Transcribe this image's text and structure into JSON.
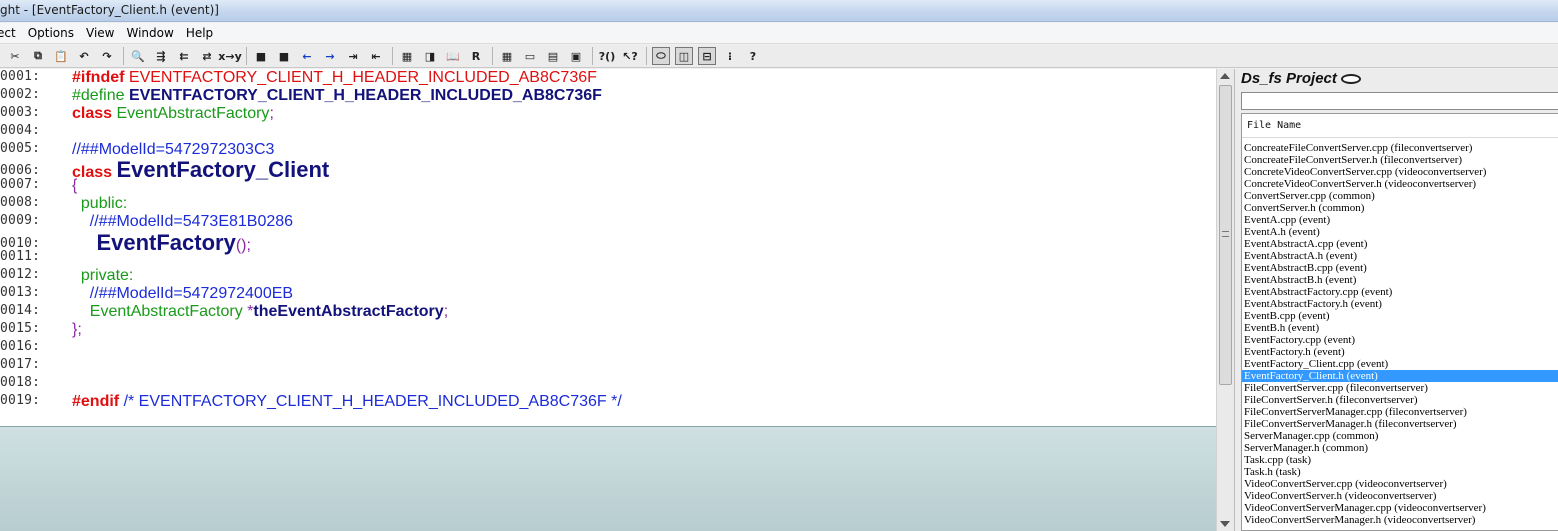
{
  "window": {
    "title": "ght - [EventFactory_Client.h (event)]"
  },
  "menu": [
    "ect",
    "Options",
    "View",
    "Window",
    "Help"
  ],
  "toolbar": {
    "buttons": [
      {
        "name": "cut-icon",
        "glyph": "✂"
      },
      {
        "name": "copy-icon",
        "glyph": "⧉"
      },
      {
        "name": "paste-icon",
        "glyph": "📋"
      },
      {
        "name": "undo-icon",
        "glyph": "↶"
      },
      {
        "name": "redo-icon",
        "glyph": "↷"
      },
      {
        "name": "find-icon",
        "glyph": "🔍"
      },
      {
        "name": "find-next-icon",
        "glyph": "⇶"
      },
      {
        "name": "find-prev-icon",
        "glyph": "⇇"
      },
      {
        "name": "replace-icon",
        "glyph": "⇄"
      },
      {
        "name": "regex-icon",
        "glyph": "x→y"
      },
      {
        "name": "bookmark-toggle-icon",
        "glyph": "■"
      },
      {
        "name": "bookmark-clear-icon",
        "glyph": "■"
      },
      {
        "name": "back-arrow-icon",
        "glyph": "←"
      },
      {
        "name": "forward-arrow-icon",
        "glyph": "→"
      },
      {
        "name": "jump-icon",
        "glyph": "⇥"
      },
      {
        "name": "jump-back-icon",
        "glyph": "⇤"
      },
      {
        "name": "browse-icon",
        "glyph": "▦"
      },
      {
        "name": "symbol-icon",
        "glyph": "◨"
      },
      {
        "name": "book-icon",
        "glyph": "📖"
      },
      {
        "name": "relation-icon",
        "glyph": "R"
      },
      {
        "name": "layout-1-icon",
        "glyph": "▦"
      },
      {
        "name": "layout-2-icon",
        "glyph": "▭"
      },
      {
        "name": "layout-3-icon",
        "glyph": "▤"
      },
      {
        "name": "layout-4-icon",
        "glyph": "▣"
      },
      {
        "name": "info-icon",
        "glyph": "?()"
      },
      {
        "name": "context-help-icon",
        "glyph": "↖?"
      },
      {
        "name": "project-toggle-icon",
        "glyph": "⬭"
      },
      {
        "name": "context-window-icon",
        "glyph": "◫"
      },
      {
        "name": "relation-window-icon",
        "glyph": "⊟"
      },
      {
        "name": "symbol-window-icon",
        "glyph": "⁝"
      },
      {
        "name": "help-window-icon",
        "glyph": "?"
      }
    ]
  },
  "editor": {
    "lines": [
      {
        "num": "00001:",
        "segments": [
          {
            "t": "#ifndef ",
            "c": "kw-red"
          },
          {
            "t": "EVENTFACTORY_CLIENT_H_HEADER_INCLUDED_AB8C736F",
            "c": "red"
          }
        ]
      },
      {
        "num": "00002:",
        "segments": [
          {
            "t": "#define ",
            "c": "green"
          },
          {
            "t": "EVENTFACTORY_CLIENT_H_HEADER_INCLUDED_AB8C736F",
            "c": "navy"
          }
        ]
      },
      {
        "num": "00003:",
        "segments": [
          {
            "t": "class ",
            "c": "kw-red"
          },
          {
            "t": "EventAbstractFactory",
            "c": "green"
          },
          {
            "t": ";",
            "c": "purple"
          }
        ]
      },
      {
        "num": "00004:",
        "segments": []
      },
      {
        "num": "00005:",
        "segments": [
          {
            "t": "//##ModelId=5472972303C3",
            "c": "blue"
          }
        ]
      },
      {
        "num": "00006:",
        "segments": [
          {
            "t": "class ",
            "c": "kw-red"
          },
          {
            "t": "EventFactory_Client",
            "c": "big"
          }
        ]
      },
      {
        "num": "00007:",
        "segments": [
          {
            "t": "{",
            "c": "purple"
          }
        ]
      },
      {
        "num": "00008:",
        "segments": [
          {
            "t": "  public:",
            "c": "green"
          }
        ]
      },
      {
        "num": "00009:",
        "segments": [
          {
            "t": "    //##ModelId=5473E81B0286",
            "c": "blue"
          }
        ]
      },
      {
        "num": "00010:",
        "segments": [
          {
            "t": "    EventFactory",
            "c": "big"
          },
          {
            "t": "();",
            "c": "purple"
          }
        ]
      },
      {
        "num": "00011:",
        "segments": []
      },
      {
        "num": "00012:",
        "segments": [
          {
            "t": "  private:",
            "c": "green"
          }
        ]
      },
      {
        "num": "00013:",
        "segments": [
          {
            "t": "    //##ModelId=5472972400EB",
            "c": "blue"
          }
        ]
      },
      {
        "num": "00014:",
        "segments": [
          {
            "t": "    EventAbstractFactory ",
            "c": "green"
          },
          {
            "t": "*",
            "c": "purple"
          },
          {
            "t": "theEventAbstractFactory",
            "c": "navy"
          },
          {
            "t": ";",
            "c": "purple"
          }
        ]
      },
      {
        "num": "00015:",
        "segments": [
          {
            "t": "};",
            "c": "purple"
          }
        ]
      },
      {
        "num": "00016:",
        "segments": []
      },
      {
        "num": "00017:",
        "segments": []
      },
      {
        "num": "00018:",
        "segments": []
      },
      {
        "num": "00019:",
        "segments": [
          {
            "t": "#endif ",
            "c": "kw-red"
          },
          {
            "t": "/* EVENTFACTORY_CLIENT_H_HEADER_INCLUDED_AB8C736F */",
            "c": "blue"
          }
        ]
      }
    ]
  },
  "project": {
    "title": "Ds_fs Project",
    "column_header": "File Name",
    "search_value": "",
    "selected_index": 19,
    "files": [
      "ConcreateFileConvertServer.cpp (fileconvertserver)",
      "ConcreateFileConvertServer.h (fileconvertserver)",
      "ConcreteVideoConvertServer.cpp (videoconvertserver)",
      "ConcreteVideoConvertServer.h (videoconvertserver)",
      "ConvertServer.cpp (common)",
      "ConvertServer.h (common)",
      "EventA.cpp (event)",
      "EventA.h (event)",
      "EventAbstractA.cpp (event)",
      "EventAbstractA.h (event)",
      "EventAbstractB.cpp (event)",
      "EventAbstractB.h (event)",
      "EventAbstractFactory.cpp (event)",
      "EventAbstractFactory.h (event)",
      "EventB.cpp (event)",
      "EventB.h (event)",
      "EventFactory.cpp (event)",
      "EventFactory.h (event)",
      "EventFactory_Client.cpp (event)",
      "EventFactory_Client.h (event)",
      "FileConvertServer.cpp (fileconvertserver)",
      "FileConvertServer.h (fileconvertserver)",
      "FileConvertServerManager.cpp (fileconvertserver)",
      "FileConvertServerManager.h (fileconvertserver)",
      "ServerManager.cpp (common)",
      "ServerManager.h (common)",
      "Task.cpp (task)",
      "Task.h (task)",
      "VideoConvertServer.cpp (videoconvertserver)",
      "VideoConvertServer.h (videoconvertserver)",
      "VideoConvertServerManager.cpp (videoconvertserver)",
      "VideoConvertServerManager.h (videoconvertserver)"
    ]
  },
  "colors": {
    "selection": "#3399ff",
    "keyword_red": "#e01010",
    "identifier_green": "#1a9a1a",
    "comment_blue": "#1c2cd8",
    "symbol_navy": "#12127a",
    "punct_purple": "#8a2aa0"
  }
}
